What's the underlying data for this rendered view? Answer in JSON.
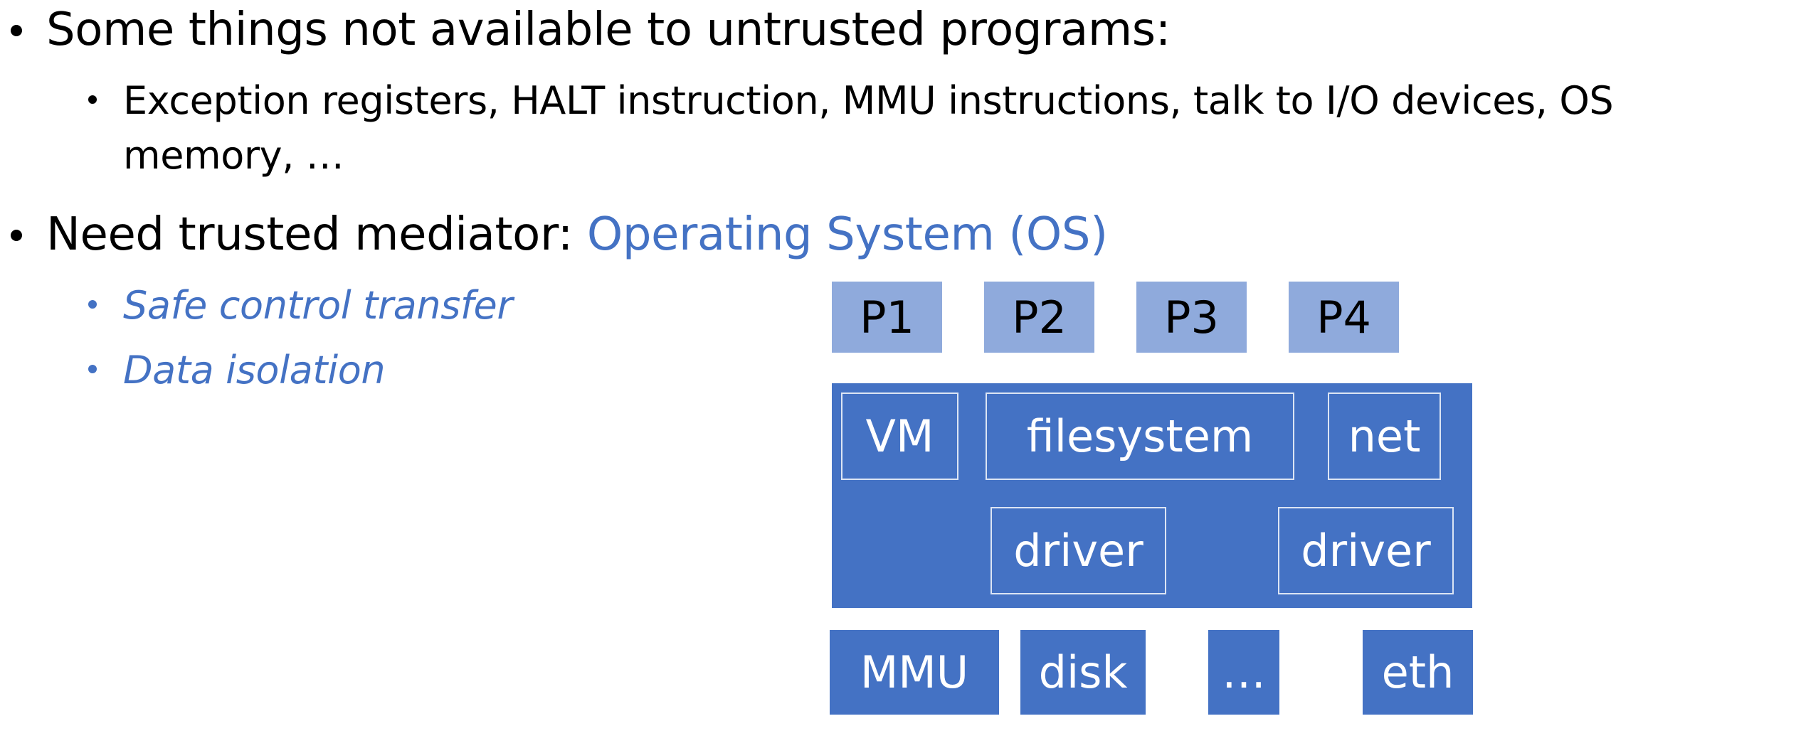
{
  "bullets": {
    "b1": "Some things not available to untrusted programs:",
    "b1_sub_line1": "Exception registers, HALT instruction, MMU instructions, talk to I/O devices, OS",
    "b1_sub_line2": "memory, …",
    "b2_prefix": "Need trusted mediator: ",
    "b2_highlight": "Operating System (OS)",
    "b2_sub1": "Safe control transfer",
    "b2_sub2": "Data isolation"
  },
  "diagram": {
    "processes": [
      "P1",
      "P2",
      "P3",
      "P4"
    ],
    "kernel": {
      "vm": "VM",
      "filesystem": "filesystem",
      "net": "net",
      "driver_left": "driver",
      "driver_right": "driver"
    },
    "hardware": [
      "MMU",
      "disk",
      "…",
      "eth"
    ]
  },
  "colors": {
    "accent": "#4472c4",
    "process_fill": "#8faadc",
    "kernel_fill": "#4472c4",
    "inner_border": "#dce5f4"
  }
}
